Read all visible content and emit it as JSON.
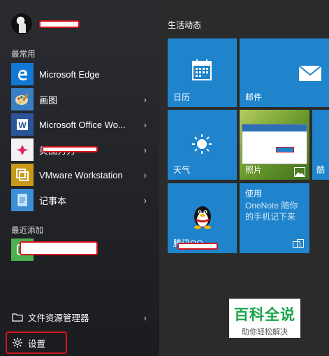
{
  "start_menu": {
    "user_name": "",
    "frequent_label": "最常用",
    "recent_label": "最近添加",
    "apps": [
      {
        "label": "Microsoft Edge",
        "has_arrow": false
      },
      {
        "label": "画图",
        "has_arrow": true
      },
      {
        "label": "Microsoft Office Wo...",
        "has_arrow": true
      },
      {
        "label": "美图秀秀",
        "has_arrow": true
      },
      {
        "label": "VMware Workstation",
        "has_arrow": true
      },
      {
        "label": "记事本",
        "has_arrow": true
      }
    ],
    "recent_app": {
      "label": ""
    },
    "bottom": {
      "file_explorer_label": "文件资源管理器",
      "settings_label": "设置"
    }
  },
  "tiles": {
    "group_title": "生活动态",
    "calendar": "日历",
    "mail": "邮件",
    "weather": "天气",
    "photos": "照片",
    "edge_partial": "酷",
    "qq": "腾讯QQ",
    "onenote": {
      "title": "使用",
      "line1": "OneNote 随你",
      "line2": "的手机记下来"
    }
  },
  "watermark": {
    "title": "百科全说",
    "subtitle": "助你轻松解决"
  },
  "colors": {
    "tile_blue": "#1f84cc",
    "highlight_red": "#d7141c",
    "watermark_green": "#1aa34a"
  }
}
